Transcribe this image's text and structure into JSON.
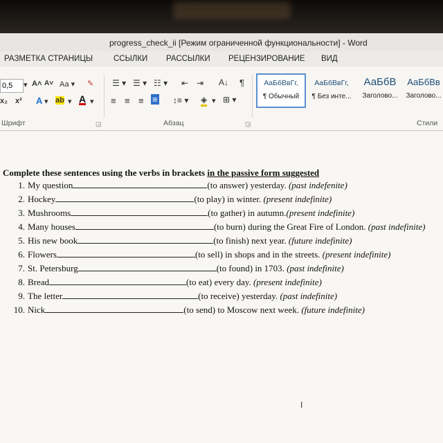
{
  "window": {
    "title": "progress_check_ii [Режим ограниченной функциональности] - Word"
  },
  "ribbon": {
    "tabs": [
      "РАЗМЕТКА СТРАНИЦЫ",
      "ССЫЛКИ",
      "РАССЫЛКИ",
      "РЕЦЕНЗИРОВАНИЕ",
      "ВИД"
    ],
    "font_size": "0,5",
    "groups": {
      "font": "Шрифт",
      "paragraph": "Абзац",
      "styles": "Стили"
    },
    "styles": [
      {
        "sample": "АаБбВвГг,",
        "caption": "¶ Обычный",
        "selected": true
      },
      {
        "sample": "АаБбВвГг,",
        "caption": "¶ Без инте...",
        "selected": false
      },
      {
        "sample": "АаБбВ",
        "caption": "Заголово...",
        "selected": false
      },
      {
        "sample": "АаБбВв",
        "caption": "Заголово...",
        "selected": false
      }
    ]
  },
  "document": {
    "heading_plain": "Complete these sentences using the verbs in brackets ",
    "heading_underlined": "in the passive form suggested",
    "items": [
      {
        "num": "1.",
        "subject": "My question",
        "verb": "(to answer) yesterday.",
        "tense": "(past indefenite)"
      },
      {
        "num": "2.",
        "subject": "Hockey",
        "verb": "(to play) in winter.",
        "tense": "(present indefinite)"
      },
      {
        "num": "3.",
        "subject": "Mushrooms",
        "verb": "(to gather) in autumn.",
        "tense": "(present indefinite)"
      },
      {
        "num": "4.",
        "subject": "Many houses",
        "verb": "(to burn) during the Great Fire of London.",
        "tense": "(past indefinite)"
      },
      {
        "num": "5.",
        "subject": "His new book",
        "verb": "(to finish) next year.",
        "tense": "(future indefinite)"
      },
      {
        "num": "6.",
        "subject": "Flowers",
        "verb": "(to sell) in shops and in the streets.",
        "tense": "(present indefinite)"
      },
      {
        "num": "7.",
        "subject": "St. Petersburg",
        "verb": "(to found) in 1703.",
        "tense": "(past indefinite)"
      },
      {
        "num": "8.",
        "subject": "Bread",
        "verb": "(to eat) every day.",
        "tense": "(present indefinite)"
      },
      {
        "num": "9.",
        "subject": "The letter",
        "verb": "(to receive) yesterday.",
        "tense": "(past indefinite)"
      },
      {
        "num": "10.",
        "subject": "Nick",
        "verb": "(to send) to Moscow next week.",
        "tense": "(future indefinite)"
      }
    ]
  }
}
